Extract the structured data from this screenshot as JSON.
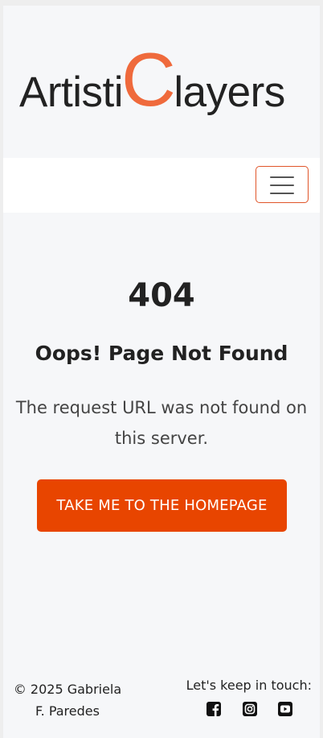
{
  "brand": {
    "text_before": "Artisti",
    "big_letter": "C",
    "text_after": "layers",
    "accent_color": "#ef6a3c"
  },
  "navbar": {
    "toggle_icon": "hamburger-icon",
    "border_color": "#e0552a"
  },
  "error": {
    "code": "404",
    "title": "Oops! Page Not Found",
    "message": "The request URL was not found on this server."
  },
  "home_button": {
    "label": "TAKE ME TO THE HOMEPAGE",
    "color": "#e84500"
  },
  "footer": {
    "copyright": "© 2025 Gabriela F. Paredes",
    "touch_label": "Let's keep in touch:",
    "social": [
      {
        "icon": "facebook-icon"
      },
      {
        "icon": "instagram-icon"
      },
      {
        "icon": "youtube-icon"
      }
    ]
  }
}
